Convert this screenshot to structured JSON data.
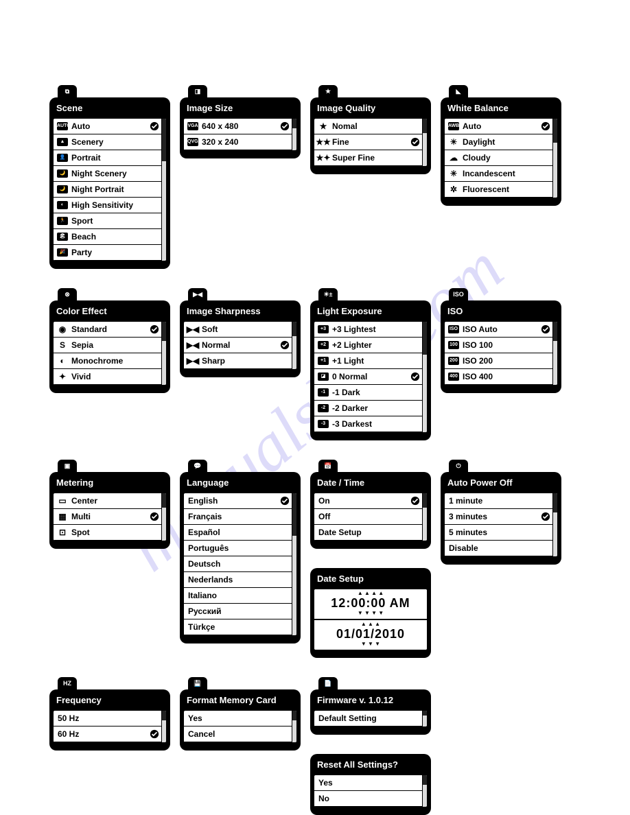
{
  "watermark": "manualslive.com",
  "panels": {
    "scene": {
      "tab": "⧉",
      "title": "Scene",
      "items": [
        {
          "icon": "AUTO",
          "box": true,
          "label": "Auto",
          "selected": true
        },
        {
          "icon": "▲",
          "box": true,
          "label": "Scenery"
        },
        {
          "icon": "👤",
          "box": true,
          "label": "Portrait"
        },
        {
          "icon": "🌙",
          "box": true,
          "label": "Night Scenery"
        },
        {
          "icon": "🌙",
          "box": true,
          "label": "Night Portrait"
        },
        {
          "icon": "◐",
          "box": true,
          "label": "High Sensitivity"
        },
        {
          "icon": "🏃",
          "box": true,
          "label": "Sport"
        },
        {
          "icon": "🏖",
          "box": true,
          "label": "Beach"
        },
        {
          "icon": "🎉",
          "box": true,
          "label": "Party"
        }
      ]
    },
    "imageSize": {
      "tab": "◨",
      "title": "Image Size",
      "items": [
        {
          "icon": "VGA",
          "box": true,
          "label": "640 x 480",
          "selected": true
        },
        {
          "icon": "QVGA",
          "box": true,
          "label": "320 x 240"
        }
      ]
    },
    "imageQuality": {
      "tab": "★",
      "title": "Image Quality",
      "items": [
        {
          "icon": "★",
          "sym": true,
          "label": "Nomal"
        },
        {
          "icon": "★★",
          "sym": true,
          "label": "Fine",
          "selected": true
        },
        {
          "icon": "★✦",
          "sym": true,
          "label": "Super Fine"
        }
      ]
    },
    "whiteBalance": {
      "tab": "◣",
      "title": "White Balance",
      "items": [
        {
          "icon": "AWB",
          "box": true,
          "label": "Auto",
          "selected": true
        },
        {
          "icon": "☀",
          "sym": true,
          "label": "Daylight"
        },
        {
          "icon": "☁",
          "sym": true,
          "label": "Cloudy"
        },
        {
          "icon": "✳",
          "sym": true,
          "label": "Incandescent"
        },
        {
          "icon": "✲",
          "sym": true,
          "label": "Fluorescent"
        }
      ]
    },
    "colorEffect": {
      "tab": "⊗",
      "title": "Color Effect",
      "items": [
        {
          "icon": "◉",
          "sym": true,
          "label": "Standard",
          "selected": true
        },
        {
          "icon": "S",
          "sym": true,
          "label": "Sepia"
        },
        {
          "icon": "◐",
          "sym": true,
          "label": "Monochrome"
        },
        {
          "icon": "✦",
          "sym": true,
          "label": "Vivid"
        }
      ]
    },
    "imageSharpness": {
      "tab": "▶◀",
      "title": "Image Sharpness",
      "items": [
        {
          "icon": "▶◀",
          "sym": true,
          "label": "Soft"
        },
        {
          "icon": "▶◀",
          "sym": true,
          "label": "Normal",
          "selected": true
        },
        {
          "icon": "▶◀",
          "sym": true,
          "label": "Sharp"
        }
      ]
    },
    "lightExposure": {
      "tab": "☀±",
      "title": "Light Exposure",
      "items": [
        {
          "icon": "+3",
          "box": true,
          "label": "+3 Lightest"
        },
        {
          "icon": "+2",
          "box": true,
          "label": "+2 Lighter"
        },
        {
          "icon": "+1",
          "box": true,
          "label": "+1 Light"
        },
        {
          "icon": "◪",
          "box": true,
          "label": "0 Normal",
          "selected": true
        },
        {
          "icon": "-1",
          "box": true,
          "label": "-1 Dark"
        },
        {
          "icon": "-2",
          "box": true,
          "label": "-2 Darker"
        },
        {
          "icon": "-3",
          "box": true,
          "label": "-3 Darkest"
        }
      ]
    },
    "iso": {
      "tab": "ISO",
      "title": "ISO",
      "items": [
        {
          "icon": "ISO",
          "box": true,
          "label": "ISO Auto",
          "selected": true
        },
        {
          "icon": "100",
          "box": true,
          "label": "ISO 100"
        },
        {
          "icon": "200",
          "box": true,
          "label": "ISO 200"
        },
        {
          "icon": "400",
          "box": true,
          "label": "ISO 400"
        }
      ]
    },
    "metering": {
      "tab": "▣",
      "title": "Metering",
      "items": [
        {
          "icon": "▭",
          "sym": true,
          "label": "Center"
        },
        {
          "icon": "▦",
          "sym": true,
          "label": "Multi",
          "selected": true
        },
        {
          "icon": "⊡",
          "sym": true,
          "label": "Spot"
        }
      ]
    },
    "language": {
      "tab": "💬",
      "title": "Language",
      "items": [
        {
          "label": "English",
          "selected": true
        },
        {
          "label": "Français"
        },
        {
          "label": "Español"
        },
        {
          "label": "Português"
        },
        {
          "label": "Deutsch"
        },
        {
          "label": "Nederlands"
        },
        {
          "label": "Italiano"
        },
        {
          "label": "Русский"
        },
        {
          "label": "Türkçe"
        }
      ]
    },
    "dateTime": {
      "tab": "📅",
      "title": "Date / Time",
      "items": [
        {
          "label": "On",
          "selected": true
        },
        {
          "label": "Off"
        },
        {
          "label": "Date Setup"
        }
      ]
    },
    "dateSetup": {
      "title": "Date Setup",
      "time": "12:00:00 AM",
      "date": "01/01/2010"
    },
    "autoPowerOff": {
      "tab": "⏻",
      "title": "Auto Power Off",
      "items": [
        {
          "label": "1 minute"
        },
        {
          "label": "3 minutes",
          "selected": true
        },
        {
          "label": "5 minutes"
        },
        {
          "label": "Disable"
        }
      ]
    },
    "frequency": {
      "tab": "HZ",
      "title": "Frequency",
      "items": [
        {
          "label": "50 Hz"
        },
        {
          "label": "60 Hz",
          "selected": true
        }
      ]
    },
    "formatCard": {
      "tab": "💾",
      "title": "Format Memory Card",
      "items": [
        {
          "label": "Yes"
        },
        {
          "label": "Cancel"
        }
      ]
    },
    "firmware": {
      "tab": "📄",
      "title": "Firmware v. 1.0.12",
      "items": [
        {
          "label": "Default Setting",
          "center": true
        }
      ]
    },
    "resetAll": {
      "title": "Reset All Settings?",
      "items": [
        {
          "label": "Yes"
        },
        {
          "label": "No"
        }
      ]
    }
  }
}
